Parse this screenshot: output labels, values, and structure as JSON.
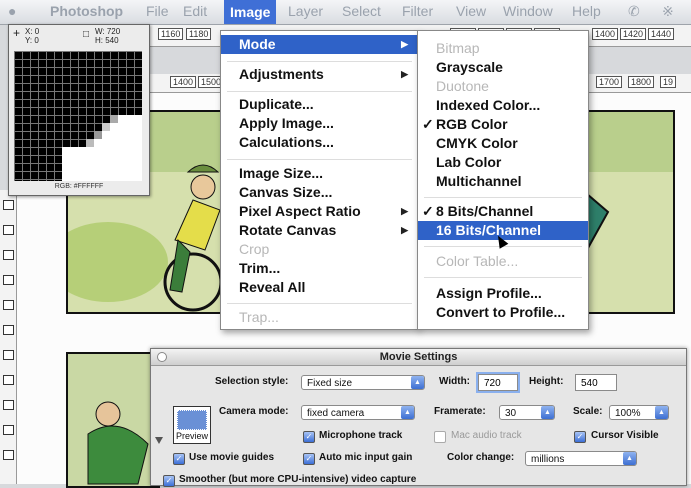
{
  "menubar": {
    "app": "Photoshop",
    "items": [
      "File",
      "Edit",
      "Image",
      "Layer",
      "Select",
      "Filter",
      "View",
      "Window",
      "Help"
    ]
  },
  "ruler_top": [
    "1160",
    "1180",
    "1320",
    "1340",
    "1360",
    "1380",
    "1400",
    "1420",
    "1440"
  ],
  "ruler_second": [
    "1400",
    "1500",
    "1700",
    "1800",
    "19"
  ],
  "info_panel": {
    "x": "X: 0",
    "y": "Y: 0",
    "w": "W: 720",
    "h": "H: 540",
    "rgb": "RGB: #FFFFFF"
  },
  "image_menu": {
    "items": [
      {
        "label": "Mode",
        "highlight": true,
        "submenu": true
      },
      {
        "label": "Adjustments",
        "submenu": true
      },
      {
        "label": "Duplicate..."
      },
      {
        "label": "Apply Image..."
      },
      {
        "label": "Calculations..."
      },
      {
        "label": "Image Size..."
      },
      {
        "label": "Canvas Size..."
      },
      {
        "label": "Pixel Aspect Ratio",
        "submenu": true
      },
      {
        "label": "Rotate Canvas",
        "submenu": true
      },
      {
        "label": "Crop",
        "disabled": true
      },
      {
        "label": "Trim..."
      },
      {
        "label": "Reveal All"
      },
      {
        "label": "Trap...",
        "disabled": true
      }
    ]
  },
  "mode_submenu": {
    "items": [
      {
        "label": "Bitmap",
        "disabled": true
      },
      {
        "label": "Grayscale"
      },
      {
        "label": "Duotone",
        "disabled": true
      },
      {
        "label": "Indexed Color..."
      },
      {
        "label": "RGB Color",
        "checked": true
      },
      {
        "label": "CMYK Color"
      },
      {
        "label": "Lab Color"
      },
      {
        "label": "Multichannel"
      },
      {
        "label": "8 Bits/Channel",
        "checked": true
      },
      {
        "label": "16 Bits/Channel",
        "highlight": true
      },
      {
        "label": "Color Table...",
        "disabled": true
      },
      {
        "label": "Assign Profile..."
      },
      {
        "label": "Convert to Profile..."
      }
    ],
    "check_mark": "✓",
    "arrow": "▶"
  },
  "movie_settings": {
    "title": "Movie Settings",
    "selection_style_label": "Selection style:",
    "selection_style_value": "Fixed size",
    "width_label": "Width:",
    "width_value": "720",
    "height_label": "Height:",
    "height_value": "540",
    "preview_label": "Preview",
    "camera_mode_label": "Camera mode:",
    "camera_mode_value": "fixed camera",
    "framerate_label": "Framerate:",
    "framerate_value": "30",
    "scale_label": "Scale:",
    "scale_value": "100%",
    "microphone_track": "Microphone track",
    "mac_audio_track": "Mac audio track",
    "cursor_visible": "Cursor Visible",
    "use_movie_guides": "Use movie guides",
    "auto_mic_input_gain": "Auto mic input gain",
    "color_change_label": "Color change:",
    "color_change_value": "millions",
    "smoother": "Smoother (but more CPU-intensive) video capture",
    "checkmark": "✓"
  }
}
